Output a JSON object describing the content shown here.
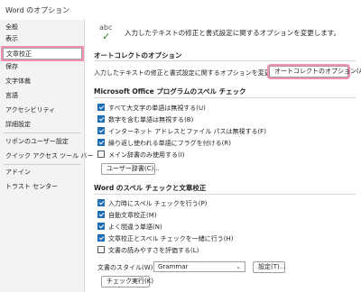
{
  "window": {
    "title": "Word のオプション"
  },
  "nav": {
    "items": [
      {
        "label": "全般"
      },
      {
        "label": "表示"
      },
      {
        "label": "文章校正"
      },
      {
        "label": "保存"
      },
      {
        "label": "文字体裁"
      },
      {
        "label": "言語"
      },
      {
        "label": "アクセシビリティ"
      },
      {
        "label": "詳細設定"
      },
      {
        "label": "リボンのユーザー設定"
      },
      {
        "label": "クイック アクセス ツール バー"
      },
      {
        "label": "アドイン"
      },
      {
        "label": "トラスト センター"
      }
    ],
    "selected": "文章校正"
  },
  "header": {
    "icon": "abc-check-icon",
    "abc": "abc",
    "check": "✓",
    "text": "入力したテキストの修正と書式設定に関するオプションを変更します。"
  },
  "autocorrect": {
    "title": "オートコレクトのオプション",
    "desc": "入力したテキストの修正と書式設定に関するオプションを変更します。",
    "button": "オートコレクトのオプション(A)..."
  },
  "office_spelling": {
    "title": "Microsoft Office プログラムのスペル チェック",
    "options": [
      {
        "label": "すべて大文字の単語は無視する(U)",
        "checked": true
      },
      {
        "label": "数字を含む単語は無視する(B)",
        "checked": true
      },
      {
        "label": "インターネット アドレスとファイル パスは無視する(F)",
        "checked": true
      },
      {
        "label": "繰り返し使われる単語にフラグを付ける(R)",
        "checked": true
      },
      {
        "label": "メイン辞書のみ使用する(I)",
        "checked": false
      }
    ],
    "dict_button": "ユーザー辞書(C)..."
  },
  "word_spelling": {
    "title": "Word のスペル チェックと文章校正",
    "options": [
      {
        "label": "入力時にスペル チェックを行う(P)",
        "checked": true
      },
      {
        "label": "自動文章校正(M)",
        "checked": true
      },
      {
        "label": "よく間違う単語(N)",
        "checked": true
      },
      {
        "label": "文章校正とスペル チェックを一緒に行う(H)",
        "checked": true
      },
      {
        "label": "文書の読みやすさを評価する(L)",
        "checked": false
      }
    ],
    "style_label": "文書のスタイル(W):",
    "style_value": "Grammar",
    "settings_button": "設定(T)...",
    "check_button": "チェック実行(K)"
  }
}
